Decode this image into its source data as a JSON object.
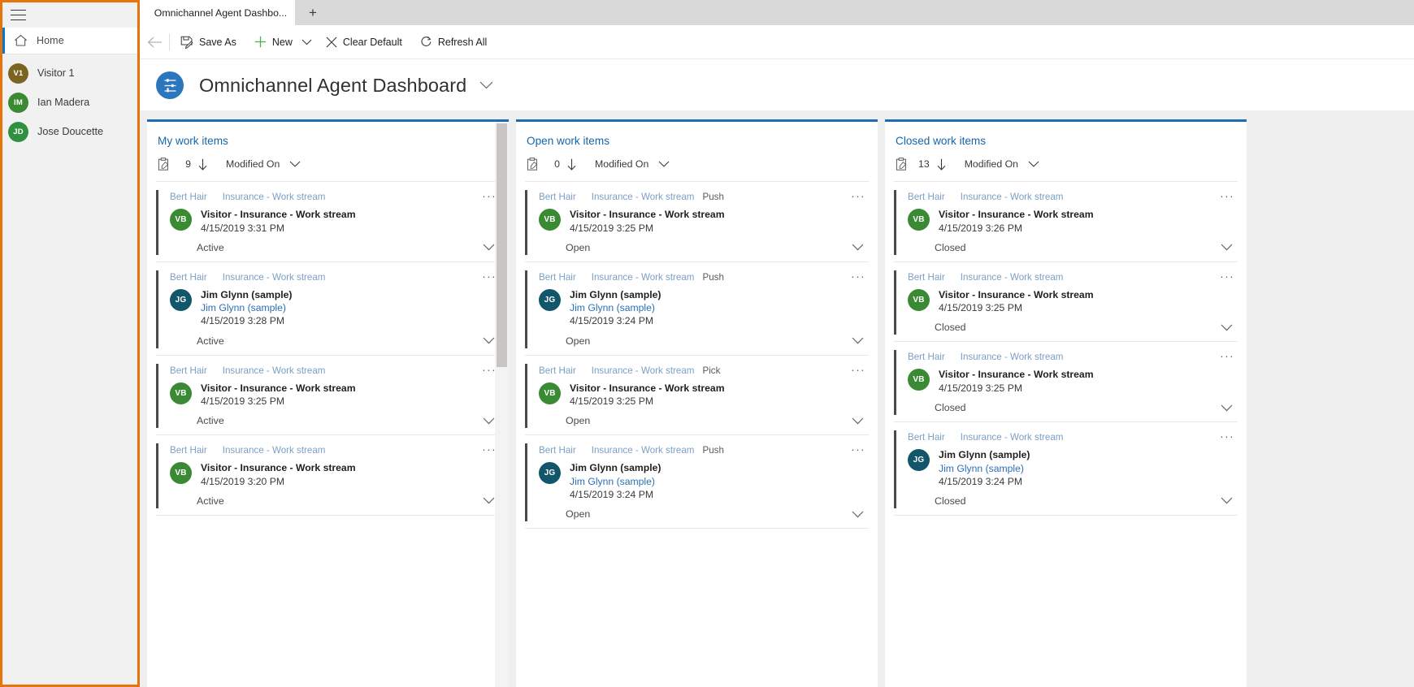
{
  "sidebar": {
    "hamburger_icon": "hamburger-menu-icon",
    "home": {
      "label": "Home",
      "icon": "home-icon"
    },
    "people": [
      {
        "initials": "V1",
        "name": "Visitor 1",
        "color": "#7a6420"
      },
      {
        "initials": "IM",
        "name": "Ian Madera",
        "color": "#3a8a34"
      },
      {
        "initials": "JD",
        "name": "Jose Doucette",
        "color": "#2f9140"
      }
    ]
  },
  "tabs": {
    "active_label": "Omnichannel Agent Dashbo...",
    "new_tab_label": "+"
  },
  "commandbar": {
    "back_label": "←",
    "save_as": "Save As",
    "new": "New",
    "clear_default": "Clear Default",
    "refresh_all": "Refresh All"
  },
  "header": {
    "title": "Omnichannel Agent Dashboard",
    "icon": "dashboard-icon",
    "caret": "chevron-down-icon"
  },
  "columns": [
    {
      "title": "My work items",
      "count": "9",
      "sort_label": "Modified On",
      "cards": [
        {
          "owner": "Bert Hair",
          "stream": "Insurance - Work stream",
          "mode": "",
          "initials": "VB",
          "avatar_color": "#3a8a34",
          "title": "Visitor - Insurance - Work stream",
          "sub": "",
          "time": "4/15/2019 3:31 PM",
          "status": "Active"
        },
        {
          "owner": "Bert Hair",
          "stream": "Insurance - Work stream",
          "mode": "",
          "initials": "JG",
          "avatar_color": "#11566a",
          "title": "Jim Glynn (sample)",
          "sub": "Jim Glynn (sample)",
          "time": "4/15/2019 3:28 PM",
          "status": "Active"
        },
        {
          "owner": "Bert Hair",
          "stream": "Insurance - Work stream",
          "mode": "",
          "initials": "VB",
          "avatar_color": "#3a8a34",
          "title": "Visitor - Insurance - Work stream",
          "sub": "",
          "time": "4/15/2019 3:25 PM",
          "status": "Active"
        },
        {
          "owner": "Bert Hair",
          "stream": "Insurance - Work stream",
          "mode": "",
          "initials": "VB",
          "avatar_color": "#3a8a34",
          "title": "Visitor - Insurance - Work stream",
          "sub": "",
          "time": "4/15/2019 3:20 PM",
          "status": "Active"
        }
      ]
    },
    {
      "title": "Open work items",
      "count": "0",
      "sort_label": "Modified On",
      "cards": [
        {
          "owner": "Bert Hair",
          "stream": "Insurance - Work stream",
          "mode": "Push",
          "initials": "VB",
          "avatar_color": "#3a8a34",
          "title": "Visitor - Insurance - Work stream",
          "sub": "",
          "time": "4/15/2019 3:25 PM",
          "status": "Open"
        },
        {
          "owner": "Bert Hair",
          "stream": "Insurance - Work stream",
          "mode": "Push",
          "initials": "JG",
          "avatar_color": "#11566a",
          "title": "Jim Glynn (sample)",
          "sub": "Jim Glynn (sample)",
          "time": "4/15/2019 3:24 PM",
          "status": "Open"
        },
        {
          "owner": "Bert Hair",
          "stream": "Insurance - Work stream",
          "mode": "Pick",
          "initials": "VB",
          "avatar_color": "#3a8a34",
          "title": "Visitor - Insurance - Work stream",
          "sub": "",
          "time": "4/15/2019 3:25 PM",
          "status": "Open"
        },
        {
          "owner": "Bert Hair",
          "stream": "Insurance - Work stream",
          "mode": "Push",
          "initials": "JG",
          "avatar_color": "#11566a",
          "title": "Jim Glynn (sample)",
          "sub": "Jim Glynn (sample)",
          "time": "4/15/2019 3:24 PM",
          "status": "Open"
        }
      ]
    },
    {
      "title": "Closed work items",
      "count": "13",
      "sort_label": "Modified On",
      "cards": [
        {
          "owner": "Bert Hair",
          "stream": "Insurance - Work stream",
          "mode": "",
          "initials": "VB",
          "avatar_color": "#3a8a34",
          "title": "Visitor - Insurance - Work stream",
          "sub": "",
          "time": "4/15/2019 3:26 PM",
          "status": "Closed"
        },
        {
          "owner": "Bert Hair",
          "stream": "Insurance - Work stream",
          "mode": "",
          "initials": "VB",
          "avatar_color": "#3a8a34",
          "title": "Visitor - Insurance - Work stream",
          "sub": "",
          "time": "4/15/2019 3:25 PM",
          "status": "Closed"
        },
        {
          "owner": "Bert Hair",
          "stream": "Insurance - Work stream",
          "mode": "",
          "initials": "VB",
          "avatar_color": "#3a8a34",
          "title": "Visitor - Insurance - Work stream",
          "sub": "",
          "time": "4/15/2019 3:25 PM",
          "status": "Closed"
        },
        {
          "owner": "Bert Hair",
          "stream": "Insurance - Work stream",
          "mode": "",
          "initials": "JG",
          "avatar_color": "#11566a",
          "title": "Jim Glynn (sample)",
          "sub": "Jim Glynn (sample)",
          "time": "4/15/2019 3:24 PM",
          "status": "Closed"
        }
      ]
    }
  ],
  "colors": {
    "accent_blue": "#1c6cb5",
    "link_blue": "#1566ab",
    "highlight_orange": "#e8720c"
  }
}
